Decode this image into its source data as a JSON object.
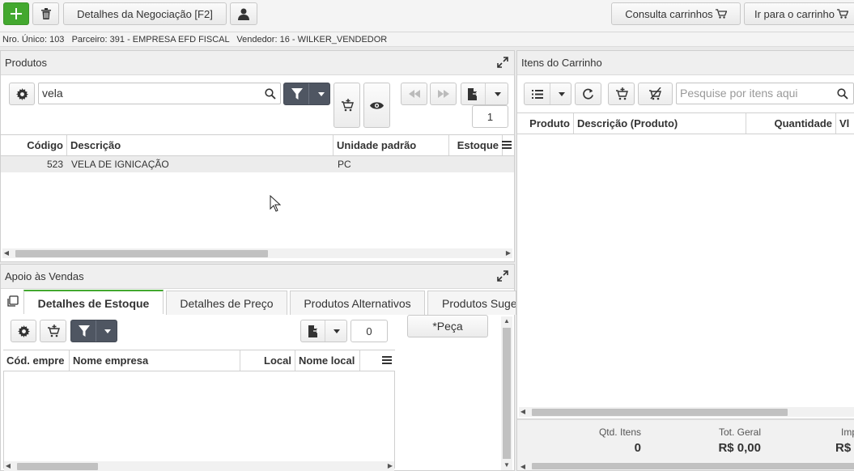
{
  "toolbar": {
    "negotiation_details": "Detalhes da Negociação [F2]",
    "consult_carts": "Consulta carrinhos",
    "go_to_cart": "Ir para o carrinho"
  },
  "info": {
    "text": "Nro. Único: 103   Parceiro: 391 - EMPRESA EFD FISCAL   Vendedor: 16 - WILKER_VENDEDOR"
  },
  "products": {
    "title": "Produtos",
    "search_value": "vela",
    "page": "1",
    "columns": [
      "Código",
      "Descrição",
      "Unidade padrão",
      "Estoque"
    ],
    "rows": [
      {
        "codigo": "523",
        "descricao": "VELA DE IGNICAÇÃO",
        "unidade": "PC",
        "estoque": ""
      }
    ]
  },
  "cart": {
    "title": "Itens do Carrinho",
    "search_placeholder": "Pesquise por itens aqui",
    "columns": [
      "Produto",
      "Descrição (Produto)",
      "Quantidade",
      "Vl"
    ],
    "summary": {
      "qtd_itens_label": "Qtd. Itens",
      "qtd_itens_value": "0",
      "tot_geral_label": "Tot. Geral",
      "tot_geral_value": "R$ 0,00",
      "imp_label": "Imp",
      "imp_value": "R$"
    }
  },
  "sales_support": {
    "title": "Apoio às Vendas",
    "tabs": [
      "Detalhes de Estoque",
      "Detalhes de Preço",
      "Produtos Alternativos",
      "Produtos Suge"
    ],
    "page": "0",
    "columns": [
      "Cód. empre",
      "Nome empresa",
      "Local",
      "Nome local"
    ],
    "side_label": "*Peça"
  },
  "colors": {
    "green": "#43a82f",
    "dark_button": "#4f5662"
  }
}
